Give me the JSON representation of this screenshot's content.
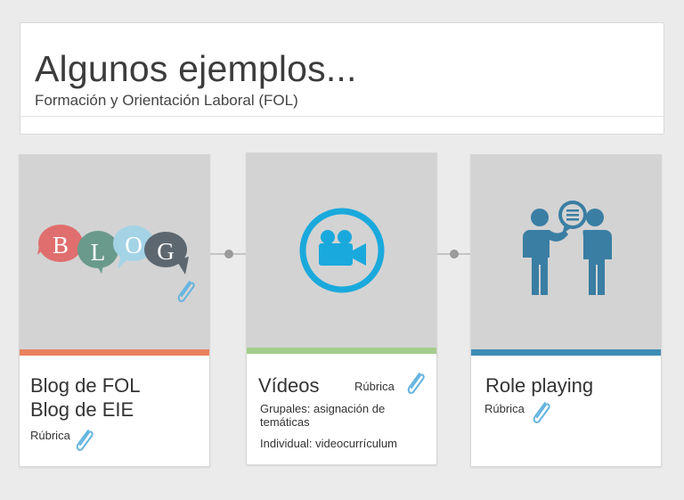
{
  "header": {
    "title": "Algunos ejemplos...",
    "subtitle": "Formación y Orientación Laboral (FOL)"
  },
  "cards": [
    {
      "line1": "Blog de FOL",
      "line2": "Blog de EIE",
      "rubrica_label": "Rúbrica",
      "bar_color": "#e8825f",
      "icon": "blog-speech-bubbles-icon",
      "blog_letters": [
        "B",
        "L",
        "O",
        "G"
      ]
    },
    {
      "title": "Vídeos",
      "rubrica_label": "Rúbrica",
      "detail1": "Grupales: asignación de temáticas",
      "detail2": "Individual: videocurrículum",
      "bar_color": "#a3cd8b",
      "icon": "video-camera-icon"
    },
    {
      "title": "Role playing",
      "rubrica_label": "Rúbrica",
      "bar_color": "#3d8db4",
      "icon": "two-people-talking-icon"
    }
  ],
  "colors": {
    "background": "#ebebeb",
    "media_gray": "#d3d3d3",
    "paperclip": "#64b4e0",
    "camera_blue": "#1aa9dc",
    "people_blue": "#3a7ea3"
  }
}
